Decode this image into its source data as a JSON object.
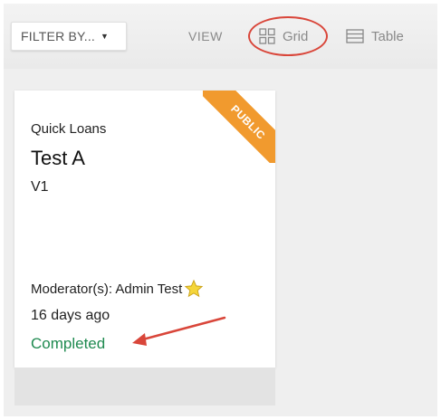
{
  "toolbar": {
    "filter_label": "FILTER BY...",
    "view_label": "VIEW",
    "grid_label": "Grid",
    "table_label": "Table",
    "grid_icon": "grid-icon",
    "table_icon": "table-icon",
    "caret_icon": "caret-down-icon"
  },
  "card": {
    "badge": "PUBLIC",
    "category": "Quick Loans",
    "title": "Test A",
    "version": "V1",
    "moderators": "Moderator(s): Admin Test",
    "moderator_icon": "star-icon",
    "time_ago": "16 days ago",
    "status": "Completed"
  },
  "colors": {
    "badge": "#f19a2e",
    "status": "#1f8a50",
    "annotation": "#d9463a"
  }
}
